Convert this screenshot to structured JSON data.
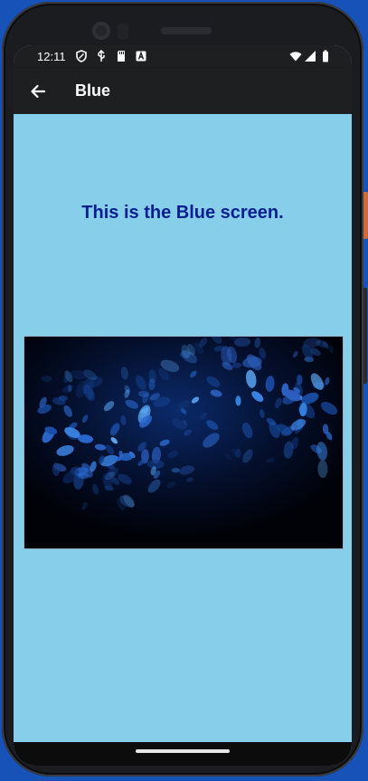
{
  "status_bar": {
    "time": "12:11",
    "left_icons": [
      "shield-icon",
      "usb-icon",
      "sd-card-icon",
      "a-box-icon"
    ],
    "right_icons": [
      "wifi-icon",
      "signal-icon",
      "battery-icon"
    ]
  },
  "app_bar": {
    "title": "Blue",
    "back_icon": "arrow-left-icon"
  },
  "content": {
    "headline": "This is the Blue screen.",
    "image_subject": "blue-leaves-photo"
  },
  "colors": {
    "content_background": "#87ceeb",
    "headline_text": "#0a1f8f",
    "app_bar": "#1e1f20",
    "device_background": "#1652b8"
  }
}
